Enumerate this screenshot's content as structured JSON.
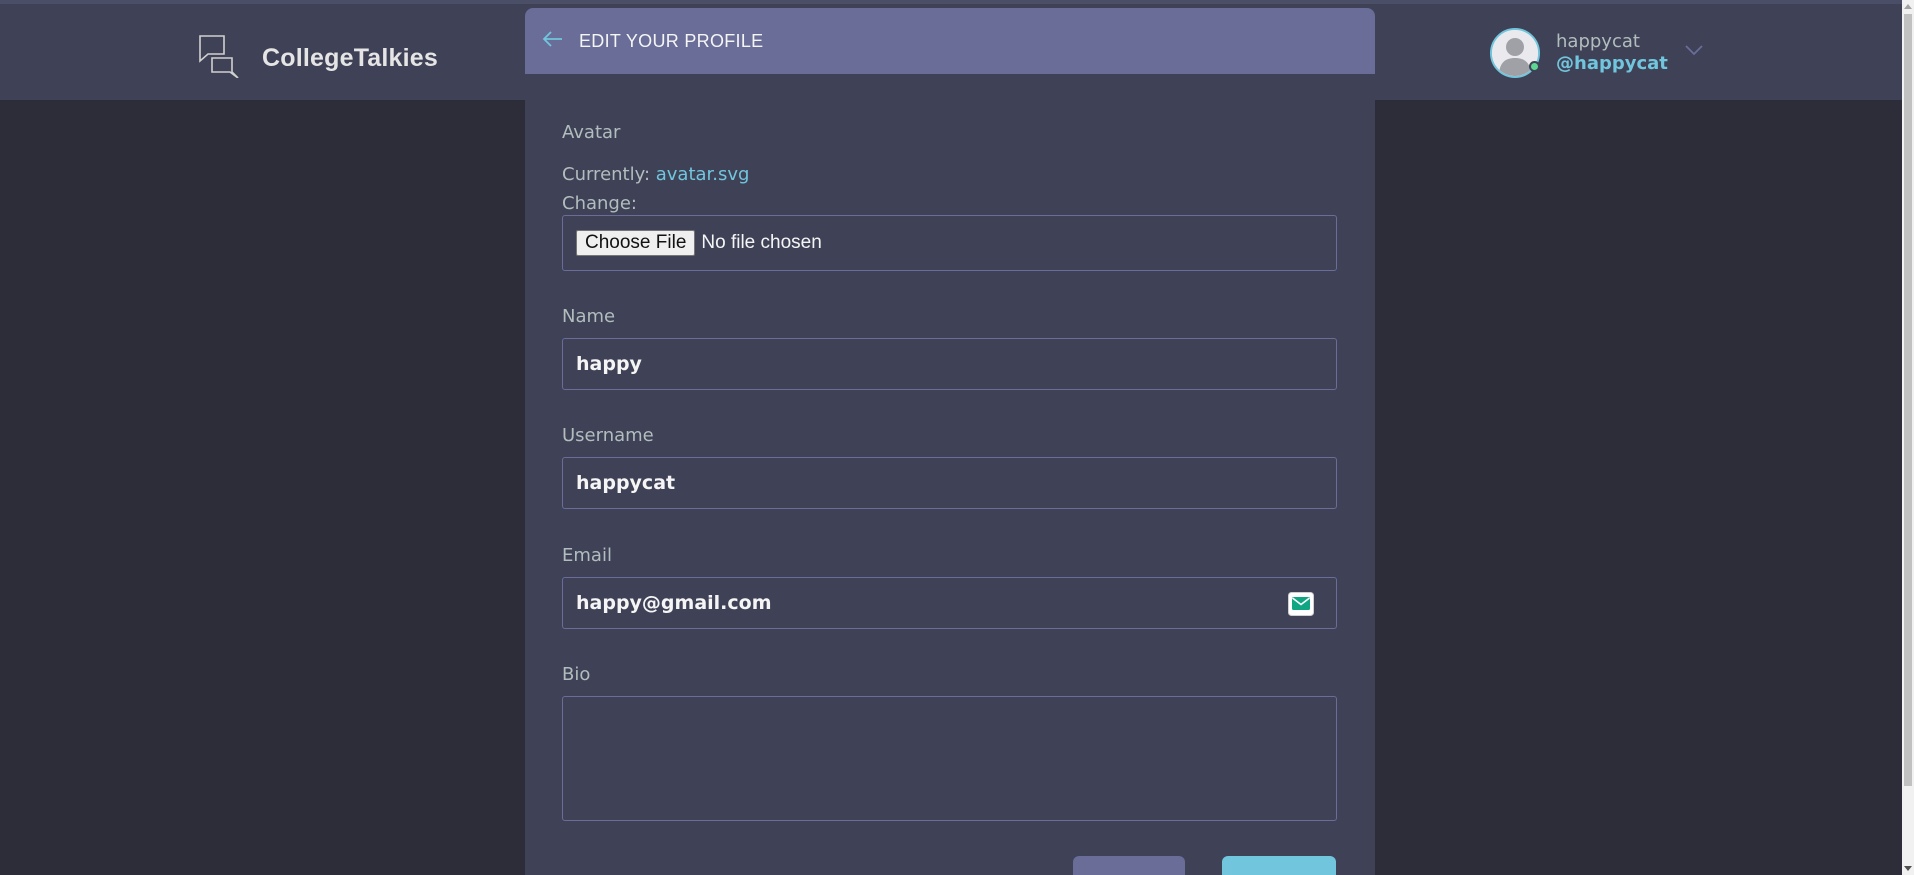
{
  "header": {
    "app_name": "CollegeTalkies",
    "user": {
      "name": "happycat",
      "handle": "@happycat"
    }
  },
  "modal": {
    "title": "EDIT YOUR PROFILE",
    "avatar": {
      "label": "Avatar",
      "currently_label": "Currently:",
      "current_file": "avatar.svg",
      "change_label": "Change:",
      "choose_button": "Choose File",
      "file_status": "No file chosen"
    },
    "name": {
      "label": "Name",
      "value": "happy"
    },
    "username": {
      "label": "Username",
      "value": "happycat"
    },
    "email": {
      "label": "Email",
      "value": "happy@gmail.com"
    },
    "bio": {
      "label": "Bio",
      "value": ""
    }
  },
  "colors": {
    "background": "#2d2d39",
    "panel": "#3f4156",
    "header_accent": "#696d97",
    "link": "#71c6dd",
    "online": "#5dd693"
  }
}
